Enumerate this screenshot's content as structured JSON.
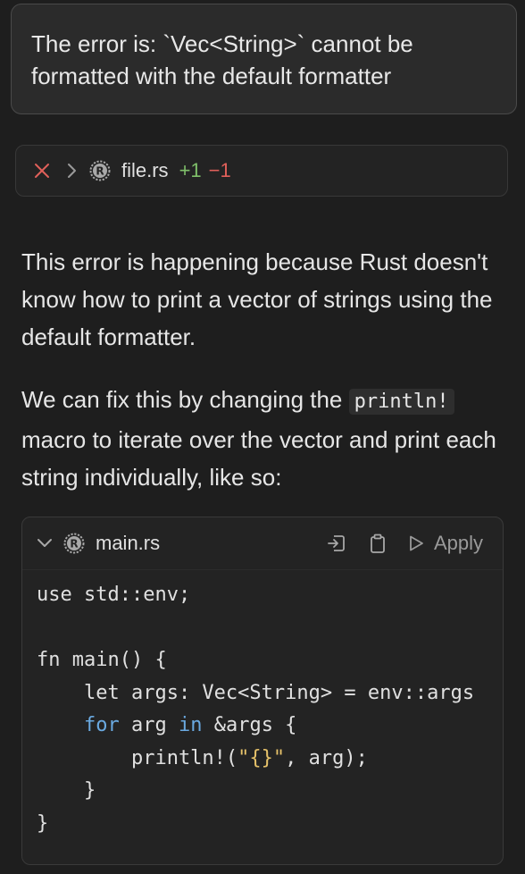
{
  "user_message": {
    "text": "The error is: `Vec<String>` cannot be formatted with the default formatter"
  },
  "file_change": {
    "filename": "file.rs",
    "added": "+1",
    "removed": "−1"
  },
  "assistant": {
    "para1": "This error is happening because Rust doesn't know how to print a vector of strings using the default formatter.",
    "para2_before": "We can fix this by changing the ",
    "para2_code": "println!",
    "para2_after": " macro to iterate over the vector and print each string individually, like so:"
  },
  "code_block": {
    "filename": "main.rs",
    "apply_label": "Apply",
    "lines": {
      "l1": "use std::env;",
      "l3": "fn main() {",
      "l4": "    let args: Vec<String> = env::args",
      "l5_kw1": "for",
      "l5_mid": " arg ",
      "l5_kw2": "in",
      "l5_end": " &args {",
      "l6_start": "        println!(",
      "l6_str": "\"{}\"",
      "l6_end": ", arg);",
      "l7": "    }",
      "l8": "}"
    }
  },
  "colors": {
    "background": "#1e1e1e",
    "keyword": "#6aa9e0",
    "string": "#e6c26a",
    "added": "#7fbf6a",
    "removed": "#e0605a"
  }
}
